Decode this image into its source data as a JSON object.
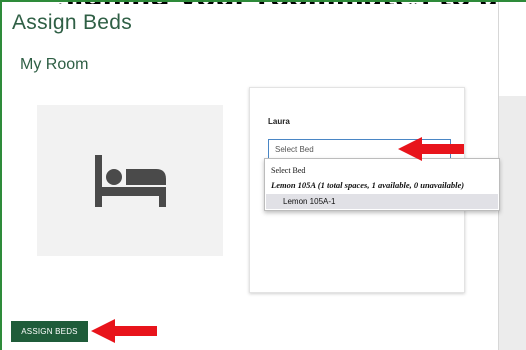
{
  "page": {
    "title": "Assign Beds",
    "section_title": "My Room"
  },
  "room": {
    "image_icon": "bed-icon"
  },
  "assignment_card": {
    "person_name": "Laura",
    "select": {
      "placeholder": "Select Bed"
    },
    "dropdown": {
      "placeholder_option": "Select Bed",
      "group_label": "Lemon 105A (1 total spaces, 1 available, 0 unavailable)",
      "options": [
        "Lemon 105A-1"
      ],
      "highlighted_option": "Lemon 105A-1"
    }
  },
  "footer": {
    "assign_label": "ASSIGN BEDS"
  },
  "annotations": {
    "arrow_color": "#e8141b"
  },
  "colors": {
    "heading": "#2f5f45",
    "button_bg": "#1f5c3a",
    "frame_border": "#2e8b3a"
  }
}
